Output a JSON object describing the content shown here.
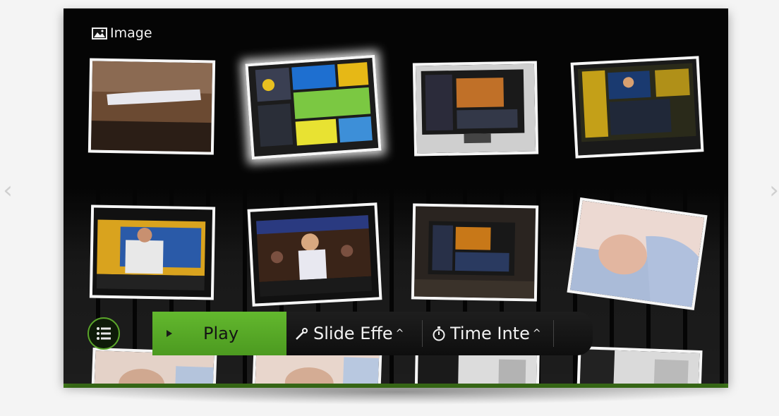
{
  "header": {
    "title": "Image",
    "icon": "image-icon"
  },
  "navigation": {
    "prev_icon": "chevron-left-icon",
    "next_icon": "chevron-right-icon",
    "prev_glyph": "‹",
    "next_glyph": "›"
  },
  "thumbnails": [
    {
      "subject": "cable-photo"
    },
    {
      "subject": "tv-apps-menu-photo",
      "selected": true
    },
    {
      "subject": "monitor-photo-1"
    },
    {
      "subject": "monitor-photo-2"
    },
    {
      "subject": "tv-host-photo"
    },
    {
      "subject": "tv-singer-photo"
    },
    {
      "subject": "monitor-photo-3"
    },
    {
      "subject": "baby-photo"
    },
    {
      "subject": "baby-photo-partial-1"
    },
    {
      "subject": "baby-photo-partial-2"
    },
    {
      "subject": "paper-photo-partial-1"
    },
    {
      "subject": "paper-photo-partial-2"
    }
  ],
  "controls": {
    "menu_icon": "list-icon",
    "play_label": "Play",
    "play_icon": "play-icon",
    "slide_effect_label": "Slide Effe",
    "slide_effect_icon": "magic-wand-icon",
    "time_interval_label": "Time Inte",
    "time_interval_icon": "stopwatch-icon",
    "caret": "^"
  },
  "colors": {
    "accent_green": "#5aa52a",
    "screen_background": "#050505",
    "frame_border": "#f6f6f6"
  }
}
